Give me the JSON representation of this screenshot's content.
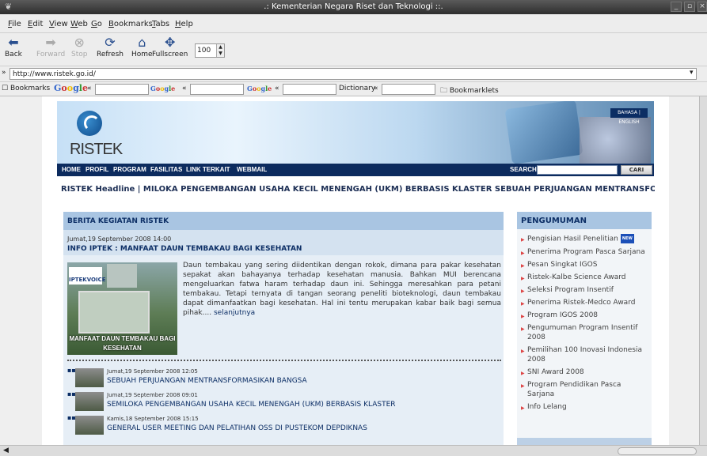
{
  "window": {
    "title": ".: Kementerian Negara Riset dan Teknologi ::.",
    "buttons": [
      "_",
      "▫",
      "×"
    ]
  },
  "menu": [
    "File",
    "Edit",
    "View",
    "Web",
    "Go",
    "Bookmarks",
    "Tabs",
    "Help"
  ],
  "toolbar": {
    "back": "Back",
    "forward": "Forward",
    "stop": "Stop",
    "refresh": "Refresh",
    "home": "Home",
    "fullscreen": "Fullscreen",
    "zoom": "100"
  },
  "url": "http://www.ristek.go.id/",
  "bookmarks_bar": {
    "bookmarks": "Bookmarks",
    "google": "Google",
    "groups": "Google GROUPS",
    "froogle": "Google FROOGLE",
    "dictionary": "Dictionary",
    "bookmarklets": "Bookmarklets",
    "chevron": "«"
  },
  "site": {
    "logo": "RISTEK",
    "lang": "BAHASA | ENGLISH",
    "nav": [
      "HOME",
      "PROFIL",
      "PROGRAM",
      "FASILITAS",
      "LINK TERKAIT",
      "WEBMAIL"
    ],
    "search_label": "SEARCH",
    "search_button": "CARI",
    "ticker": "RISTEK Headline |  MILOKA PENGEMBANGAN USAHA KECIL MENENGAH (UKM) BERBASIS KLASTER     SEBUAH PERJUANGAN MENTRANSFORMASIKA"
  },
  "berita": {
    "header": "BERITA KEGIATAN RISTEK",
    "featured_date": "Jumat,19 September 2008 14:00",
    "featured_title": "INFO IPTEK : MANFAAT DAUN TEMBAKAU BAGI KESEHATAN",
    "image_brand": "IPTEKVOICE",
    "image_caption": "MANFAAT DAUN TEMBAKAU BAGI KESEHATAN",
    "lead": "Daun tembakau yang sering diidentikan dengan rokok, dimana para pakar kesehatan sepakat akan bahayanya terhadap kesehatan manusia. Bahkan MUI berencana mengeluarkan fatwa haram terhadap daun ini. Sehingga meresahkan para petani tembakau. Tetapi ternyata di tangan seorang peneliti bioteknologi, daun tembakau dapat dimanfaatkan bagi kesehatan. Hal ini tentu merupakan kabar baik bagi semua pihak....",
    "more": "selanjutnya",
    "items": [
      {
        "date": "Jumat,19 September 2008 12:05",
        "title": "SEBUAH PERJUANGAN MENTRANSFORMASIKAN BANGSA"
      },
      {
        "date": "Jumat,19 September 2008 09:01",
        "title": "SEMILOKA PENGEMBANGAN USAHA KECIL MENENGAH (UKM) BERBASIS KLASTER"
      },
      {
        "date": "Kamis,18 September 2008 15:15",
        "title": "GENERAL USER MEETING DAN PELATIHAN OSS DI PUSTEKOM DEPDIKNAS"
      }
    ]
  },
  "pengumuman": {
    "header": "PENGUMUMAN",
    "new_badge": "NEW",
    "items": [
      "Pengisian Hasil Penelitian",
      "Penerima Program Pasca Sarjana",
      "Pesan Singkat IGOS",
      "Ristek-Kalbe Science Award",
      "Seleksi Program Insentif",
      "Penerima Ristek-Medco Award",
      "Program IGOS 2008",
      "Pengumuman Program Insentif 2008",
      "Pemilihan 100 Inovasi Indonesia 2008",
      "SNI Award 2008",
      "Program Pendidikan Pasca Sarjana",
      "Info Lelang"
    ]
  }
}
